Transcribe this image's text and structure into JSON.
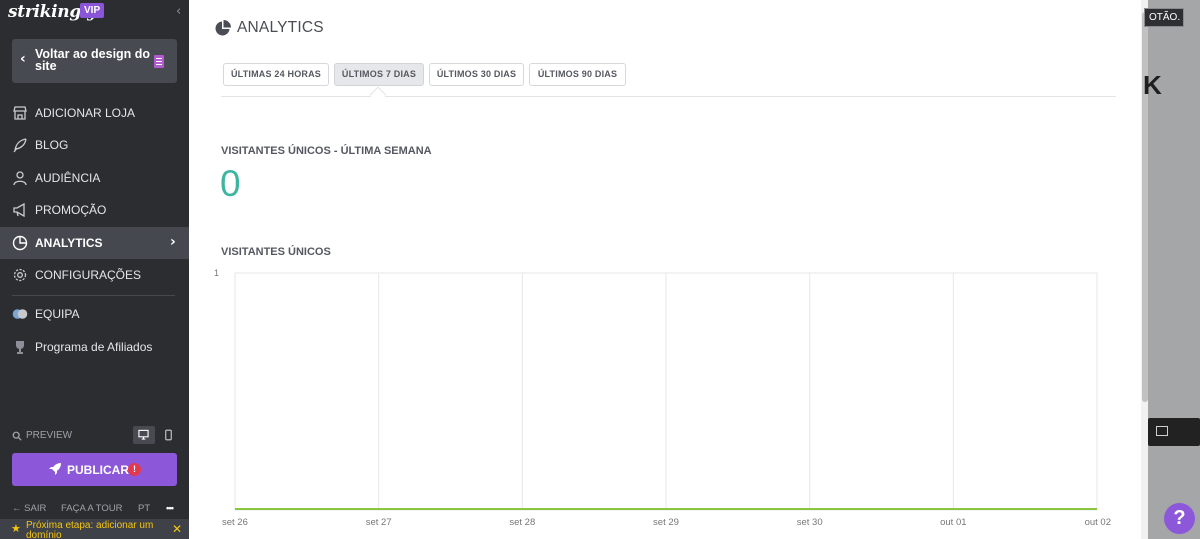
{
  "sidebar": {
    "brand": "strikingly",
    "vip_badge": "VIP",
    "back_label": "Voltar ao design do site",
    "nav_items": [
      {
        "label": "ADICIONAR LOJA",
        "icon": "store-icon"
      },
      {
        "label": "BLOG",
        "icon": "feather-icon"
      },
      {
        "label": "AUDIÊNCIA",
        "icon": "users-icon"
      },
      {
        "label": "PROMOÇÃO",
        "icon": "megaphone-icon"
      },
      {
        "label": "ANALYTICS",
        "icon": "pie-chart-icon",
        "active": true
      },
      {
        "label": "CONFIGURAÇÕES",
        "icon": "gear-icon"
      },
      {
        "label": "EQUIPA",
        "icon": "team-icon"
      },
      {
        "label": "Programa de Afiliados",
        "icon": "trophy-icon"
      }
    ],
    "preview_label": "PREVIEW",
    "publish_label": "PUBLICAR",
    "publish_alert": "!",
    "footer": {
      "exit": "SAIR",
      "tour": "FAÇA A TOUR",
      "lang": "PT",
      "more": "•••"
    },
    "next_step": "Próxima etapa: adicionar um domínio"
  },
  "main": {
    "title": "ANALYTICS",
    "tabs": [
      {
        "label": "ÚLTIMAS 24 HORAS",
        "active": false
      },
      {
        "label": "ÚLTIMOS 7 DIAS",
        "active": true
      },
      {
        "label": "ÚLTIMOS 30 DIAS",
        "active": false
      },
      {
        "label": "ÚLTIMOS 90 DIAS",
        "active": false
      }
    ],
    "stat": {
      "title": "VISITANTES ÚNICOS - ÚLTIMA SEMANA",
      "value": "0"
    },
    "chart_title": "VISITANTES ÚNICOS"
  },
  "chart_data": {
    "type": "line",
    "title": "VISITANTES ÚNICOS",
    "categories": [
      "set 26",
      "set 27",
      "set 28",
      "set 29",
      "set 30",
      "out 01",
      "out 02"
    ],
    "series": [
      {
        "values": [
          0,
          0,
          0,
          0,
          0,
          0,
          0
        ]
      }
    ],
    "ylim": [
      0,
      1
    ],
    "yticks": [
      "1"
    ],
    "grid": true,
    "line_color": "#8cc63f"
  },
  "background": {
    "button_text": "OTÃO.",
    "glyph": "K"
  },
  "colors": {
    "accent": "#8c58d9",
    "stat": "#3db5a0",
    "sidebar": "#2b2d31"
  }
}
